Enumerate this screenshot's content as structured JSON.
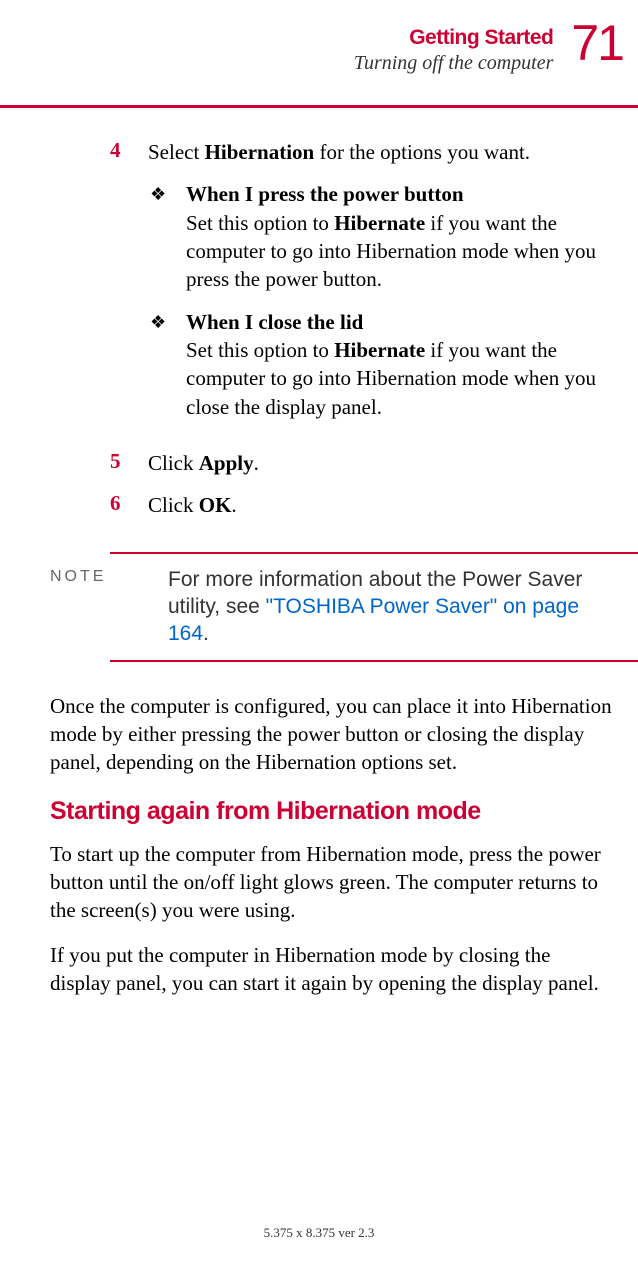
{
  "header": {
    "chapter": "Getting Started",
    "section": "Turning off the computer",
    "page": "71"
  },
  "steps": {
    "s4": {
      "num": "4",
      "text_pre": "Select ",
      "text_bold": "Hibernation",
      "text_post": " for the options you want."
    },
    "bullets": {
      "b1": {
        "title": "When I press the power button",
        "desc_pre": "Set this option to ",
        "desc_bold": "Hibernate",
        "desc_post": " if you want the computer to go into Hibernation mode when you press the power button."
      },
      "b2": {
        "title": "When I close the lid",
        "desc_pre": "Set this option to ",
        "desc_bold": "Hibernate",
        "desc_post": " if you want the computer to go into Hibernation mode when you close the display panel."
      }
    },
    "s5": {
      "num": "5",
      "text_pre": "Click ",
      "text_bold": "Apply",
      "text_post": "."
    },
    "s6": {
      "num": "6",
      "text_pre": "Click ",
      "text_bold": "OK",
      "text_post": "."
    }
  },
  "note": {
    "label": "NOTE",
    "text": "For more information about the Power Saver utility, see ",
    "link": "\"TOSHIBA Power Saver\" on page 164",
    "punct": "."
  },
  "paragraphs": {
    "p1": "Once the computer is configured, you can place it into Hibernation mode by either pressing the power button or closing the display panel, depending on the Hibernation options set.",
    "p2": "To start up the computer from Hibernation mode, press the power button until the on/off light glows green. The computer returns to the screen(s) you were using.",
    "p3": "If you put the computer in Hibernation mode by closing the display panel, you can start it again by opening the display panel."
  },
  "subsection": "Starting again from Hibernation mode",
  "footer": "5.375 x 8.375 ver 2.3"
}
